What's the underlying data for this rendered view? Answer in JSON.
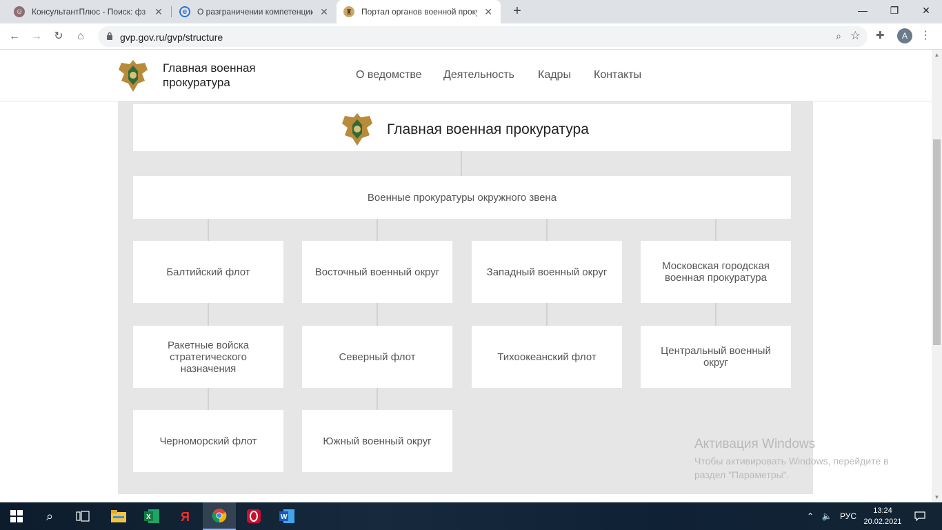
{
  "browser": {
    "tabs": [
      {
        "title": "КонсультантПлюс - Поиск: фз о",
        "icon": "consultant-icon"
      },
      {
        "title": "О разграничении компетенции",
        "icon": "edge-e-icon"
      },
      {
        "title": "Портал органов военной прокуратуры",
        "icon": "emblem-icon",
        "active": true
      }
    ],
    "new_tab": "+",
    "url": "gvp.gov.ru/gvp/structure",
    "profile_initial": "A"
  },
  "site": {
    "title": "Главная военная прокуратура",
    "nav": [
      "О ведомстве",
      "Деятельность",
      "Кадры",
      "Контакты"
    ]
  },
  "org": {
    "root": "Главная военная прокуратура",
    "level": "Военные прокуратуры окружного звена",
    "units": [
      "Балтийский флот",
      "Восточный военный округ",
      "Западный военный округ",
      "Московская городская военная прокуратура",
      "Ракетные войска стратегического назначения",
      "Северный флот",
      "Тихоокеанский флот",
      "Центральный военный округ",
      "Черноморский флот",
      "Южный военный округ"
    ]
  },
  "watermark": {
    "title": "Активация Windows",
    "text": "Чтобы активировать Windows, перейдите в раздел \"Параметры\"."
  },
  "taskbar": {
    "language": "РУС",
    "time": "13:24",
    "date": "20.02.2021"
  },
  "colors": {
    "tabstrip": "#dee1e6",
    "panel": "#e6e6e6",
    "box": "#ffffff",
    "connector": "#d2d2d2"
  }
}
